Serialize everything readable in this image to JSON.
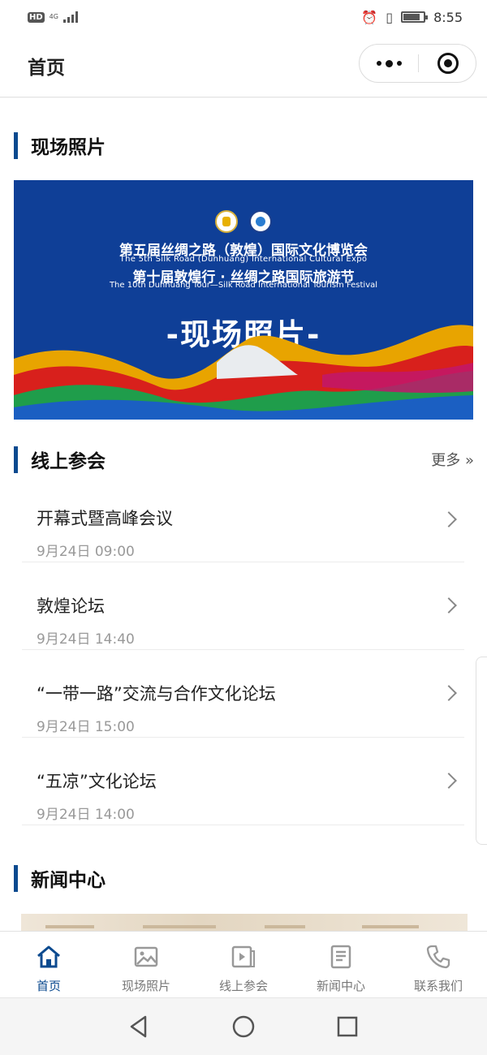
{
  "status": {
    "network": "HD",
    "network_type": "4G",
    "time": "8:55"
  },
  "titlebar": {
    "title": "首页"
  },
  "photos": {
    "heading": "现场照片",
    "banner": {
      "line1": "第五届丝绸之路（敦煌）国际文化博览会",
      "line2": "The 5th Silk Road (Dunhuang) International Cultural Expo",
      "line3": "第十届敦煌行 · 丝绸之路国际旅游节",
      "line4": "The 10th Dunhuang Tour—Silk Road International Tourism Festival",
      "big": "-现场照片-"
    }
  },
  "online": {
    "heading": "线上参会",
    "more": "更多 »",
    "items": [
      {
        "title": "开幕式暨高峰会议",
        "date": "9月24日 09:00"
      },
      {
        "title": "敦煌论坛",
        "date": "9月24日 14:40"
      },
      {
        "title": "“一带一路”交流与合作文化论坛",
        "date": "9月24日 15:00"
      },
      {
        "title": "“五凉”文化论坛",
        "date": "9月24日 14:00"
      }
    ]
  },
  "news": {
    "heading": "新闻中心"
  },
  "tabs": [
    {
      "label": "首页",
      "icon": "home-icon",
      "active": true
    },
    {
      "label": "现场照片",
      "icon": "image-icon"
    },
    {
      "label": "线上参会",
      "icon": "video-icon"
    },
    {
      "label": "新闻中心",
      "icon": "document-icon"
    },
    {
      "label": "联系我们",
      "icon": "phone-icon"
    }
  ],
  "colors": {
    "accent": "#0b4a8f",
    "banner_bg": "#0f3f97"
  }
}
